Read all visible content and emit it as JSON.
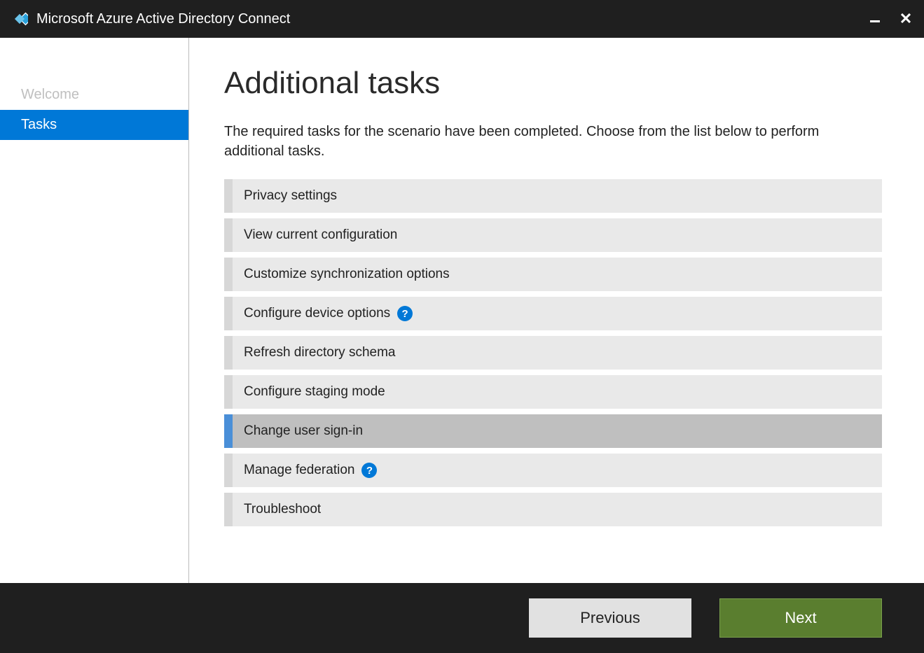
{
  "titlebar": {
    "title": "Microsoft Azure Active Directory Connect"
  },
  "sidebar": {
    "items": [
      {
        "label": "Welcome",
        "state": "disabled"
      },
      {
        "label": "Tasks",
        "state": "active"
      }
    ]
  },
  "main": {
    "title": "Additional tasks",
    "description": "The required tasks for the scenario have been completed. Choose from the list below to perform additional tasks.",
    "tasks": [
      {
        "label": "Privacy settings",
        "selected": false,
        "help": false
      },
      {
        "label": "View current configuration",
        "selected": false,
        "help": false
      },
      {
        "label": "Customize synchronization options",
        "selected": false,
        "help": false
      },
      {
        "label": "Configure device options",
        "selected": false,
        "help": true
      },
      {
        "label": "Refresh directory schema",
        "selected": false,
        "help": false
      },
      {
        "label": "Configure staging mode",
        "selected": false,
        "help": false
      },
      {
        "label": "Change user sign-in",
        "selected": true,
        "help": false
      },
      {
        "label": "Manage federation",
        "selected": false,
        "help": true
      },
      {
        "label": "Troubleshoot",
        "selected": false,
        "help": false
      }
    ]
  },
  "footer": {
    "previous_label": "Previous",
    "next_label": "Next"
  }
}
